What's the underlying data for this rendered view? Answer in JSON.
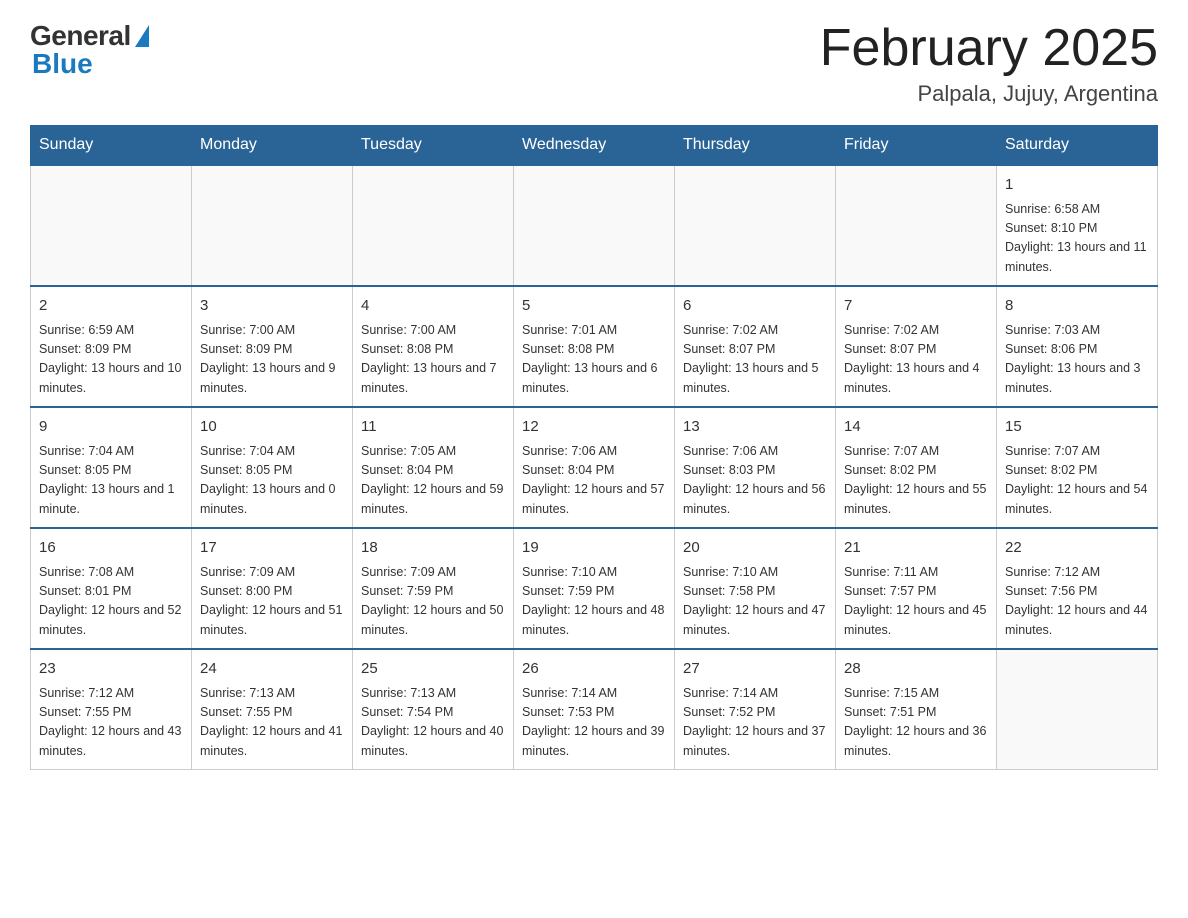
{
  "header": {
    "logo_general": "General",
    "logo_blue": "Blue",
    "month_title": "February 2025",
    "location": "Palpala, Jujuy, Argentina"
  },
  "weekdays": [
    "Sunday",
    "Monday",
    "Tuesday",
    "Wednesday",
    "Thursday",
    "Friday",
    "Saturday"
  ],
  "weeks": [
    [
      {
        "day": "",
        "sunrise": "",
        "sunset": "",
        "daylight": ""
      },
      {
        "day": "",
        "sunrise": "",
        "sunset": "",
        "daylight": ""
      },
      {
        "day": "",
        "sunrise": "",
        "sunset": "",
        "daylight": ""
      },
      {
        "day": "",
        "sunrise": "",
        "sunset": "",
        "daylight": ""
      },
      {
        "day": "",
        "sunrise": "",
        "sunset": "",
        "daylight": ""
      },
      {
        "day": "",
        "sunrise": "",
        "sunset": "",
        "daylight": ""
      },
      {
        "day": "1",
        "sunrise": "Sunrise: 6:58 AM",
        "sunset": "Sunset: 8:10 PM",
        "daylight": "Daylight: 13 hours and 11 minutes."
      }
    ],
    [
      {
        "day": "2",
        "sunrise": "Sunrise: 6:59 AM",
        "sunset": "Sunset: 8:09 PM",
        "daylight": "Daylight: 13 hours and 10 minutes."
      },
      {
        "day": "3",
        "sunrise": "Sunrise: 7:00 AM",
        "sunset": "Sunset: 8:09 PM",
        "daylight": "Daylight: 13 hours and 9 minutes."
      },
      {
        "day": "4",
        "sunrise": "Sunrise: 7:00 AM",
        "sunset": "Sunset: 8:08 PM",
        "daylight": "Daylight: 13 hours and 7 minutes."
      },
      {
        "day": "5",
        "sunrise": "Sunrise: 7:01 AM",
        "sunset": "Sunset: 8:08 PM",
        "daylight": "Daylight: 13 hours and 6 minutes."
      },
      {
        "day": "6",
        "sunrise": "Sunrise: 7:02 AM",
        "sunset": "Sunset: 8:07 PM",
        "daylight": "Daylight: 13 hours and 5 minutes."
      },
      {
        "day": "7",
        "sunrise": "Sunrise: 7:02 AM",
        "sunset": "Sunset: 8:07 PM",
        "daylight": "Daylight: 13 hours and 4 minutes."
      },
      {
        "day": "8",
        "sunrise": "Sunrise: 7:03 AM",
        "sunset": "Sunset: 8:06 PM",
        "daylight": "Daylight: 13 hours and 3 minutes."
      }
    ],
    [
      {
        "day": "9",
        "sunrise": "Sunrise: 7:04 AM",
        "sunset": "Sunset: 8:05 PM",
        "daylight": "Daylight: 13 hours and 1 minute."
      },
      {
        "day": "10",
        "sunrise": "Sunrise: 7:04 AM",
        "sunset": "Sunset: 8:05 PM",
        "daylight": "Daylight: 13 hours and 0 minutes."
      },
      {
        "day": "11",
        "sunrise": "Sunrise: 7:05 AM",
        "sunset": "Sunset: 8:04 PM",
        "daylight": "Daylight: 12 hours and 59 minutes."
      },
      {
        "day": "12",
        "sunrise": "Sunrise: 7:06 AM",
        "sunset": "Sunset: 8:04 PM",
        "daylight": "Daylight: 12 hours and 57 minutes."
      },
      {
        "day": "13",
        "sunrise": "Sunrise: 7:06 AM",
        "sunset": "Sunset: 8:03 PM",
        "daylight": "Daylight: 12 hours and 56 minutes."
      },
      {
        "day": "14",
        "sunrise": "Sunrise: 7:07 AM",
        "sunset": "Sunset: 8:02 PM",
        "daylight": "Daylight: 12 hours and 55 minutes."
      },
      {
        "day": "15",
        "sunrise": "Sunrise: 7:07 AM",
        "sunset": "Sunset: 8:02 PM",
        "daylight": "Daylight: 12 hours and 54 minutes."
      }
    ],
    [
      {
        "day": "16",
        "sunrise": "Sunrise: 7:08 AM",
        "sunset": "Sunset: 8:01 PM",
        "daylight": "Daylight: 12 hours and 52 minutes."
      },
      {
        "day": "17",
        "sunrise": "Sunrise: 7:09 AM",
        "sunset": "Sunset: 8:00 PM",
        "daylight": "Daylight: 12 hours and 51 minutes."
      },
      {
        "day": "18",
        "sunrise": "Sunrise: 7:09 AM",
        "sunset": "Sunset: 7:59 PM",
        "daylight": "Daylight: 12 hours and 50 minutes."
      },
      {
        "day": "19",
        "sunrise": "Sunrise: 7:10 AM",
        "sunset": "Sunset: 7:59 PM",
        "daylight": "Daylight: 12 hours and 48 minutes."
      },
      {
        "day": "20",
        "sunrise": "Sunrise: 7:10 AM",
        "sunset": "Sunset: 7:58 PM",
        "daylight": "Daylight: 12 hours and 47 minutes."
      },
      {
        "day": "21",
        "sunrise": "Sunrise: 7:11 AM",
        "sunset": "Sunset: 7:57 PM",
        "daylight": "Daylight: 12 hours and 45 minutes."
      },
      {
        "day": "22",
        "sunrise": "Sunrise: 7:12 AM",
        "sunset": "Sunset: 7:56 PM",
        "daylight": "Daylight: 12 hours and 44 minutes."
      }
    ],
    [
      {
        "day": "23",
        "sunrise": "Sunrise: 7:12 AM",
        "sunset": "Sunset: 7:55 PM",
        "daylight": "Daylight: 12 hours and 43 minutes."
      },
      {
        "day": "24",
        "sunrise": "Sunrise: 7:13 AM",
        "sunset": "Sunset: 7:55 PM",
        "daylight": "Daylight: 12 hours and 41 minutes."
      },
      {
        "day": "25",
        "sunrise": "Sunrise: 7:13 AM",
        "sunset": "Sunset: 7:54 PM",
        "daylight": "Daylight: 12 hours and 40 minutes."
      },
      {
        "day": "26",
        "sunrise": "Sunrise: 7:14 AM",
        "sunset": "Sunset: 7:53 PM",
        "daylight": "Daylight: 12 hours and 39 minutes."
      },
      {
        "day": "27",
        "sunrise": "Sunrise: 7:14 AM",
        "sunset": "Sunset: 7:52 PM",
        "daylight": "Daylight: 12 hours and 37 minutes."
      },
      {
        "day": "28",
        "sunrise": "Sunrise: 7:15 AM",
        "sunset": "Sunset: 7:51 PM",
        "daylight": "Daylight: 12 hours and 36 minutes."
      },
      {
        "day": "",
        "sunrise": "",
        "sunset": "",
        "daylight": ""
      }
    ]
  ]
}
